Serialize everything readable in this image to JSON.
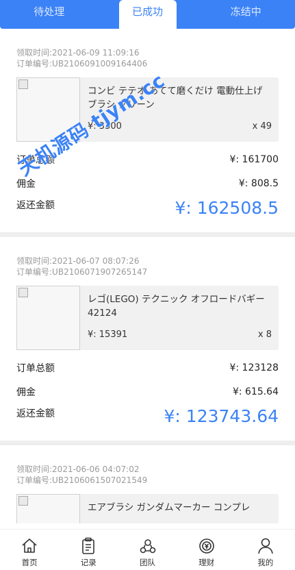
{
  "tabs": [
    {
      "label": "待处理"
    },
    {
      "label": "已成功"
    },
    {
      "label": "冻结中"
    }
  ],
  "orders": [
    {
      "time_label": "领取时间:",
      "time": "2021-06-09 11:09:16",
      "no_label": "订单编号:",
      "no": "UB2106091009164406",
      "product_name": "コンビ テテオ あてて磨くだけ 電動仕上げブラシ グリーン",
      "price": "¥: 3300",
      "qty": "x 49",
      "total_label": "订单总额",
      "total": "¥: 161700",
      "commission_label": "佣金",
      "commission": "¥: 808.5",
      "return_label": "返还金额",
      "return": "¥: 162508.5"
    },
    {
      "time_label": "领取时间:",
      "time": "2021-06-07 08:07:26",
      "no_label": "订单编号:",
      "no": "UB2106071907265147",
      "product_name": "レゴ(LEGO) テクニック オフロードバギー 42124",
      "price": "¥: 15391",
      "qty": "x 8",
      "total_label": "订单总额",
      "total": "¥: 123128",
      "commission_label": "佣金",
      "commission": "¥: 615.64",
      "return_label": "返还金额",
      "return": "¥: 123743.64"
    },
    {
      "time_label": "领取时间:",
      "time": "2021-06-06 04:07:02",
      "no_label": "订单编号:",
      "no": "UB2106061507021549",
      "product_name": "エアブラシ ガンダムマーカー コンプレ"
    }
  ],
  "watermark": "天机源码 tjym.cc",
  "nav": [
    {
      "label": "首页",
      "icon": "home-icon"
    },
    {
      "label": "记录",
      "icon": "clipboard-icon"
    },
    {
      "label": "团队",
      "icon": "team-icon"
    },
    {
      "label": "理财",
      "icon": "finance-icon"
    },
    {
      "label": "我的",
      "icon": "user-icon"
    }
  ],
  "colors": {
    "accent": "#3b82f6"
  }
}
